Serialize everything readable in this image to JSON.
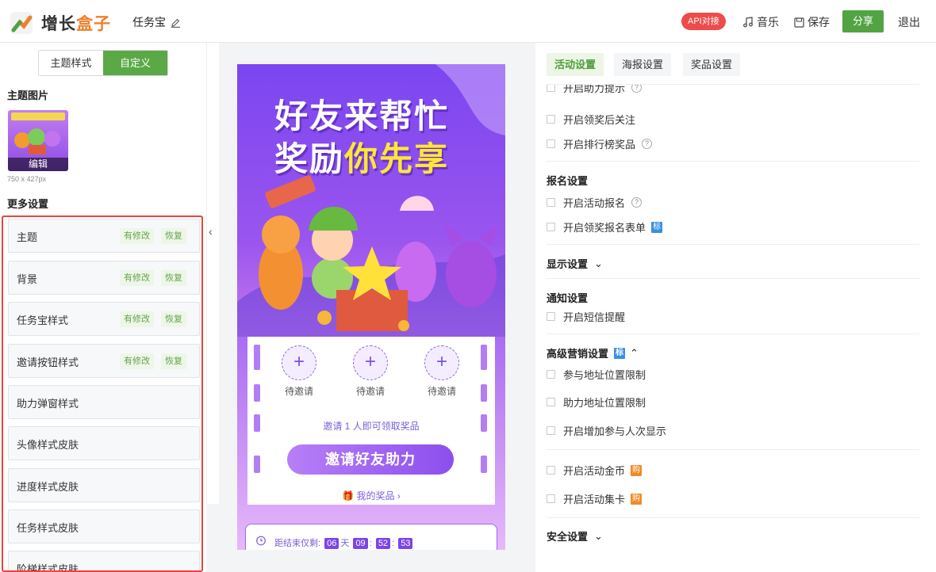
{
  "header": {
    "logo_a": "增长",
    "logo_b": "盒子",
    "project": "任务宝",
    "api_badge": "API对接",
    "music": "音乐",
    "save": "保存",
    "share": "分享",
    "exit": "退出"
  },
  "left": {
    "seg_theme": "主题样式",
    "seg_custom": "自定义",
    "theme_image_title": "主题图片",
    "edit": "编辑",
    "dimension": "750 x 427px",
    "more_title": "更多设置",
    "rows": [
      {
        "label": "主题",
        "modified": "有修改",
        "restore": "恢复"
      },
      {
        "label": "背景",
        "modified": "有修改",
        "restore": "恢复"
      },
      {
        "label": "任务宝样式",
        "modified": "有修改",
        "restore": "恢复"
      },
      {
        "label": "邀请按钮样式",
        "modified": "有修改",
        "restore": "恢复"
      },
      {
        "label": "助力弹窗样式"
      },
      {
        "label": "头像样式皮肤"
      },
      {
        "label": "进度样式皮肤"
      },
      {
        "label": "任务样式皮肤"
      },
      {
        "label": "阶梯样式皮肤"
      }
    ]
  },
  "preview": {
    "title_line1": "好友来帮忙",
    "title_line2_a": "奖励",
    "title_line2_b": "你先享",
    "slot_plus": "+",
    "slot_label": "待邀请",
    "tip": "邀请 1 人即可领取奖品",
    "invite_button": "邀请好友助力",
    "my_prize": "我的奖品",
    "timer_label": "距结束仅剩:",
    "days": "06",
    "day_unit": "天",
    "hours": "09",
    "minutes": "52",
    "seconds": "53"
  },
  "right": {
    "tabs": [
      "活动设置",
      "海报设置",
      "奖品设置"
    ],
    "opt_partial": "开启助力提示",
    "opt_follow": "开启领奖后关注",
    "opt_rank": "开启排行榜奖品",
    "sec_signup": "报名设置",
    "opt_signup": "开启活动报名",
    "opt_signup_form": "开启领奖报名表单",
    "badge_biao": "标",
    "sec_display": "显示设置",
    "sec_notify": "通知设置",
    "opt_sms": "开启短信提醒",
    "sec_advanced": "高级营销设置",
    "opt_geo1": "参与地址位置限制",
    "opt_geo2": "助力地址位置限制",
    "opt_count": "开启增加参与人次显示",
    "opt_coin": "开启活动金币",
    "opt_card": "开启活动集卡",
    "badge_gou": "购",
    "sec_security": "安全设置",
    "qm": "?"
  },
  "colors": {
    "brand_green": "#5aa846",
    "accent_orange": "#f07f2a",
    "purple": "#8a51f2",
    "highlight_red": "#e8453c"
  }
}
